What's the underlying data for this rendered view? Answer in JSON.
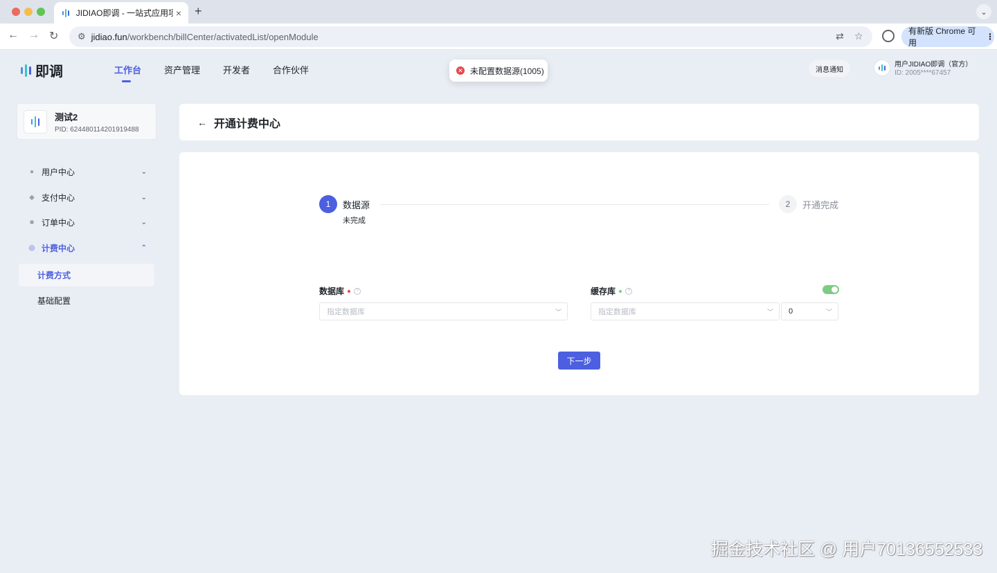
{
  "browser": {
    "tab_title": "JIDIAO即调 - 一站式应用项目管",
    "tab_close": "×",
    "new_tab": "+",
    "url_host": "jidiao.fun",
    "url_path": "/workbench/billCenter/activatedList/openModule",
    "update_label": "有新版 Chrome 可用"
  },
  "header": {
    "logo_text": "即调",
    "nav": [
      {
        "label": "工作台",
        "active": true
      },
      {
        "label": "资产管理",
        "active": false
      },
      {
        "label": "开发者",
        "active": false
      },
      {
        "label": "合作伙伴",
        "active": false
      }
    ],
    "notify_label": "消息通知",
    "user_name": "用户JIDIAO即调（官方）",
    "user_id": "ID: 2005****67457"
  },
  "toast": {
    "message": "未配置数据源(1005)",
    "status_color": "#e5484d"
  },
  "sidebar": {
    "project_name": "测试2",
    "project_pid": "PID: 624480114201919488",
    "items": [
      {
        "label": "用户中心",
        "icon": "user-icon",
        "expanded": false
      },
      {
        "label": "支付中心",
        "icon": "shield-icon",
        "expanded": false
      },
      {
        "label": "订单中心",
        "icon": "clipboard-icon",
        "expanded": false
      },
      {
        "label": "计费中心",
        "icon": "billing-icon",
        "expanded": true
      }
    ],
    "sub_items": [
      {
        "label": "计费方式",
        "active": true
      },
      {
        "label": "基础配置",
        "active": false
      }
    ]
  },
  "page": {
    "title": "开通计费中心"
  },
  "steps": [
    {
      "number": "1",
      "title": "数据源",
      "desc": "未完成",
      "active": true
    },
    {
      "number": "2",
      "title": "开通完成",
      "active": false
    }
  ],
  "form": {
    "database_label": "数据库",
    "database_placeholder": "指定数据库",
    "cache_label": "缓存库",
    "cache_placeholder": "指定数据库",
    "cache_index_value": "0",
    "cache_enabled": true,
    "next_label": "下一步"
  },
  "colors": {
    "accent": "#4c5fe0",
    "required_dot": "#e5484d",
    "optional_dot": "#7ecb83",
    "toggle_on": "#7ecb83"
  },
  "watermark": "掘金技术社区 @ 用户70136552533"
}
